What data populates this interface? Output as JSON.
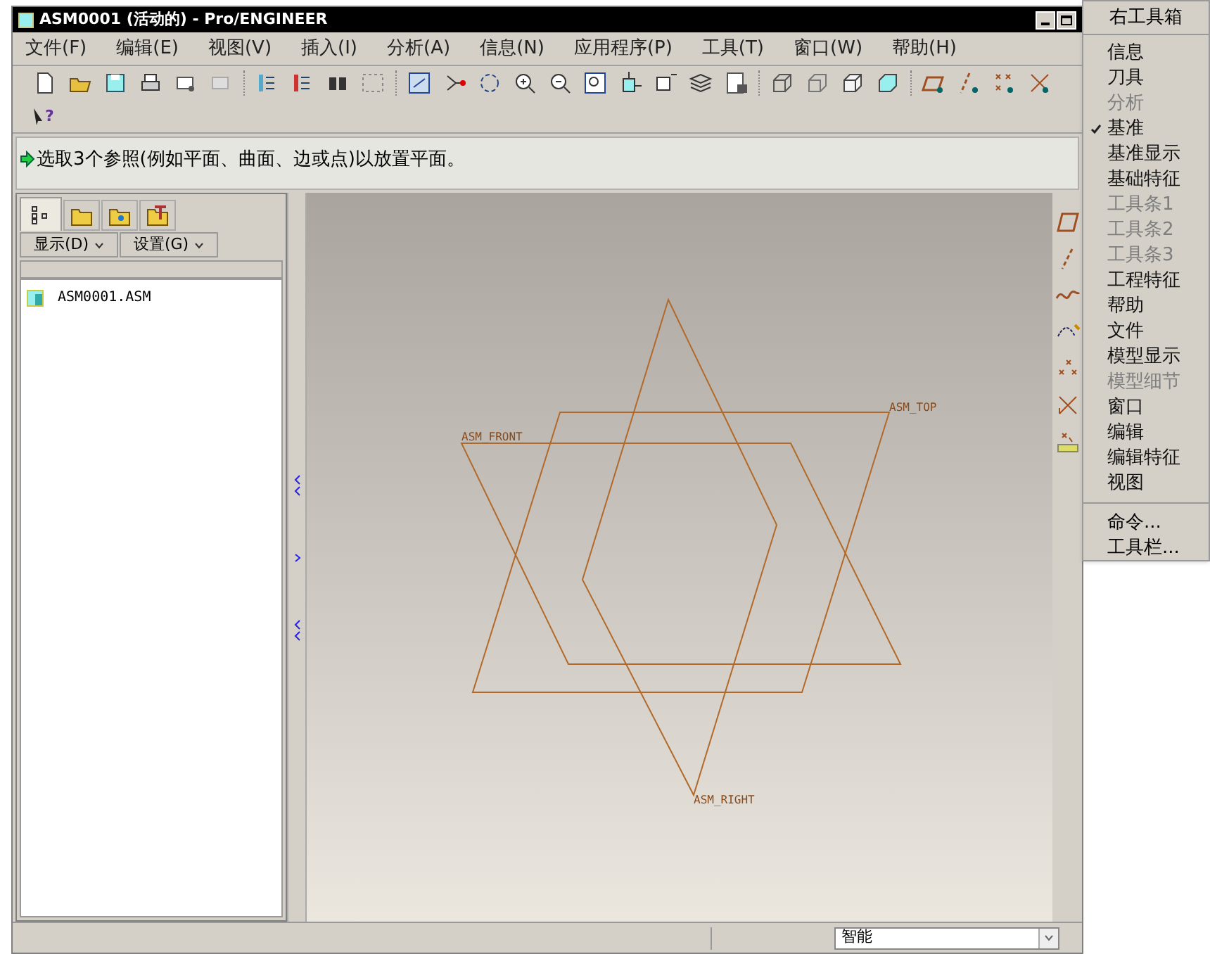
{
  "window": {
    "title": "ASM0001 (活动的) - Pro/ENGINEER"
  },
  "menu_bar": [
    "文件(F)",
    "编辑(E)",
    "视图(V)",
    "插入(I)",
    "分析(A)",
    "信息(N)",
    "应用程序(P)",
    "工具(T)",
    "窗口(W)",
    "帮助(H)"
  ],
  "help_mark": "?",
  "message": "选取3个参照(例如平面、曲面、边或点)以放置平面。",
  "navigator": {
    "tabs": [
      {
        "selected": true
      },
      {
        "selected": false
      },
      {
        "selected": false
      },
      {
        "selected": false
      }
    ],
    "buttons": [
      "显示(D)",
      "设置(G)"
    ],
    "tree": [
      {
        "label": "ASM0001.ASM"
      }
    ]
  },
  "datums": [
    {
      "label": "ASM_TOP"
    },
    {
      "label": "ASM_FRONT"
    },
    {
      "label": "ASM_RIGHT"
    }
  ],
  "status_bar": {
    "filter": "智能"
  },
  "context_menu": {
    "title": "右工具箱",
    "items": [
      {
        "label": "信息",
        "disabled": false,
        "checked": false
      },
      {
        "label": "刀具",
        "disabled": false,
        "checked": false
      },
      {
        "label": "分析",
        "disabled": true,
        "checked": false
      },
      {
        "label": "基准",
        "disabled": false,
        "checked": true
      },
      {
        "label": "基准显示",
        "disabled": false,
        "checked": false
      },
      {
        "label": "基础特征",
        "disabled": false,
        "checked": false
      },
      {
        "label": "工具条1",
        "disabled": true,
        "checked": false
      },
      {
        "label": "工具条2",
        "disabled": true,
        "checked": false
      },
      {
        "label": "工具条3",
        "disabled": true,
        "checked": false
      },
      {
        "label": "工程特征",
        "disabled": false,
        "checked": false
      },
      {
        "label": "帮助",
        "disabled": false,
        "checked": false
      },
      {
        "label": "文件",
        "disabled": false,
        "checked": false
      },
      {
        "label": "模型显示",
        "disabled": false,
        "checked": false
      },
      {
        "label": "模型细节",
        "disabled": true,
        "checked": false
      },
      {
        "label": "窗口",
        "disabled": false,
        "checked": false
      },
      {
        "label": "编辑",
        "disabled": false,
        "checked": false
      },
      {
        "label": "编辑特征",
        "disabled": false,
        "checked": false
      },
      {
        "label": "视图",
        "disabled": false,
        "checked": false
      }
    ],
    "commands": [
      "命令...",
      "工具栏..."
    ]
  }
}
